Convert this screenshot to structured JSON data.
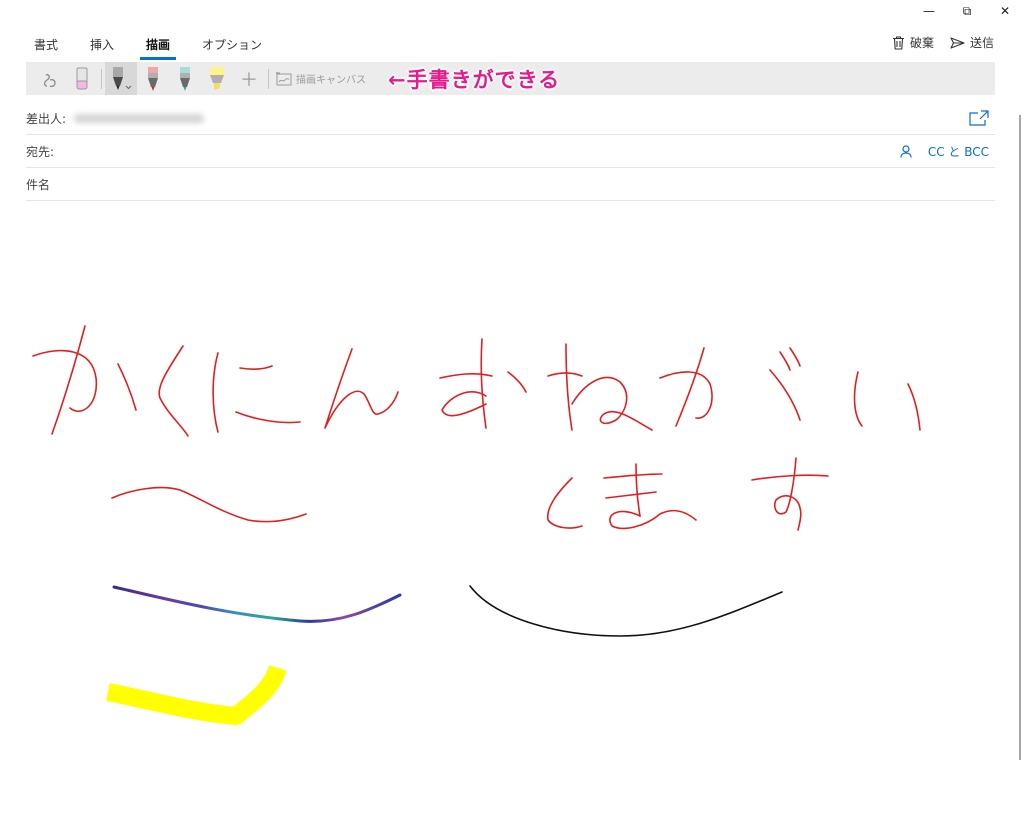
{
  "window": {
    "minimize": "—",
    "restore": "⧉",
    "close": "✕"
  },
  "tabs": [
    {
      "label": "書式"
    },
    {
      "label": "挿入"
    },
    {
      "label": "描画"
    },
    {
      "label": "オプション"
    }
  ],
  "actions": {
    "discard": "破棄",
    "send": "送信"
  },
  "toolbar": {
    "canvas_label": "描画キャンバス",
    "annotation": "←手書きができる",
    "add": "＋"
  },
  "fields": {
    "from_label": "差出人:",
    "to_label": "宛先:",
    "subject_label": "件名",
    "cc_bcc": "CC と BCC"
  },
  "colors": {
    "accent": "#0a6ed1",
    "ink_red": "#e02020",
    "ink_black": "#111111",
    "ink_yellow": "#ffff00",
    "annotation": "#e8198b"
  },
  "drawing": {
    "handwritten_text": "かくにんおねがいします〜"
  }
}
